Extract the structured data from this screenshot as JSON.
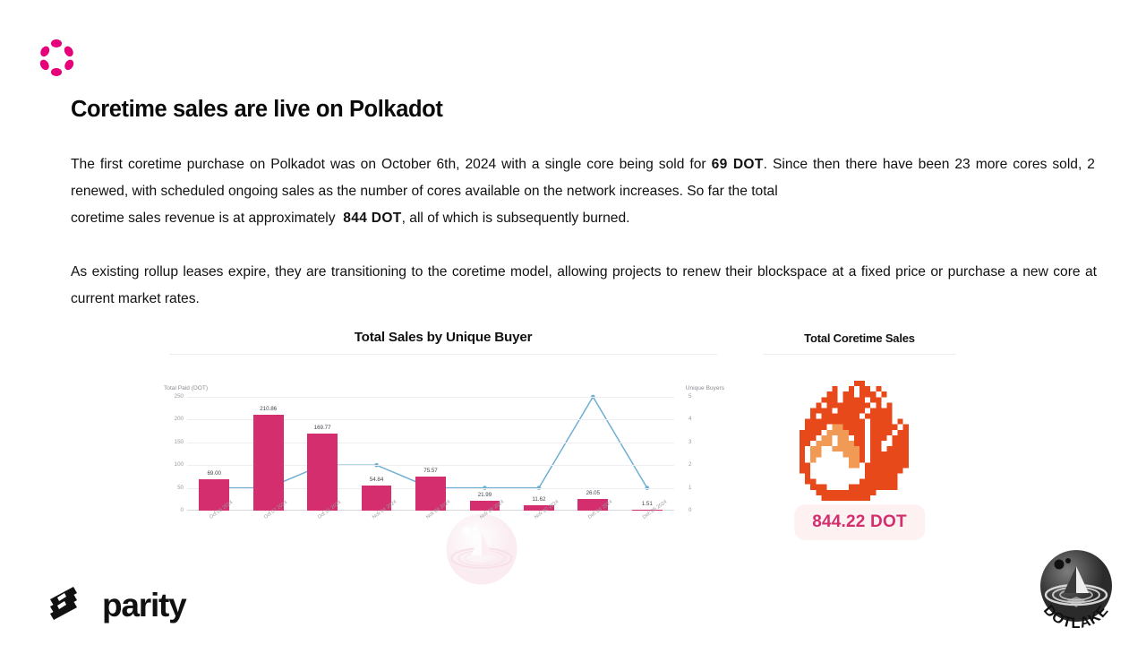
{
  "brand": {
    "polkadot_logo_name": "polkadot-logo",
    "parity_logo_text": "parity",
    "dotlake_logo_text": "DOTLAKE",
    "accent_pink": "#E6007A",
    "bar_pink": "#D42E6E",
    "line_blue": "#6FAFD4"
  },
  "headline": "Coretime sales are live on Polkadot",
  "paragraphs": {
    "p1_a": "The first coretime purchase on Polkadot was on October 6th, 2024 with a single core being sold for ",
    "p1_amount1": "69 DOT",
    "p1_b": ".  Since then there have been 23 more cores sold, 2 renewed, with scheduled ongoing sales as the number of cores available on the network increases. So far the total",
    "p1_c_pre": "coretime sales revenue is at approximately",
    "p1_amount2": "844 DOT",
    "p1_c_post": ", all of which is subsequently burned.",
    "p2": "As existing rollup leases expire, they are transitioning to the coretime model, allowing projects to renew their blockspace at a fixed price or purchase a new core at current market rates."
  },
  "sales_card": {
    "title": "Total Coretime Sales",
    "fire_icon": "pixel-fire-icon",
    "total_value": "844.22 DOT"
  },
  "chart_data": {
    "type": "bar",
    "title": "Total Sales by Unique Buyer",
    "xlabel": "",
    "ylabel": "Total Paid (DOT)",
    "y2label": "Unique Buyers",
    "categories": [
      "Oct 06 2024",
      "Oct 07 2024",
      "Oct 31 2024",
      "Nov 04 2024",
      "Nov 06 2024",
      "Nov 28 2024",
      "Nov 30 2024",
      "Dec 04 2024",
      "Dec 05 2024"
    ],
    "values": [
      69.0,
      210.86,
      169.77,
      54.84,
      75.57,
      21.99,
      11.62,
      26.05,
      1.51
    ],
    "value_labels": [
      "69.00",
      "210.86",
      "169.77",
      "54.84",
      "75.57",
      "21.99",
      "11.62",
      "26.05",
      "1.51"
    ],
    "series": [
      {
        "name": "Total Paid (DOT)",
        "type": "bar",
        "values": [
          69.0,
          210.86,
          169.77,
          54.84,
          75.57,
          21.99,
          11.62,
          26.05,
          1.51
        ]
      },
      {
        "name": "Unique Buyers",
        "type": "line",
        "values": [
          1,
          1,
          2,
          2,
          1,
          1,
          1,
          5,
          1
        ]
      }
    ],
    "ylim": [
      0,
      250
    ],
    "yticks": [
      "0",
      "50",
      "100",
      "150",
      "200",
      "250"
    ],
    "y2lim": [
      0,
      5
    ],
    "y2ticks": [
      "0",
      "1",
      "2",
      "3",
      "4",
      "5"
    ],
    "grid": true,
    "legend": "none",
    "watermark": "dotlake-watermark"
  }
}
